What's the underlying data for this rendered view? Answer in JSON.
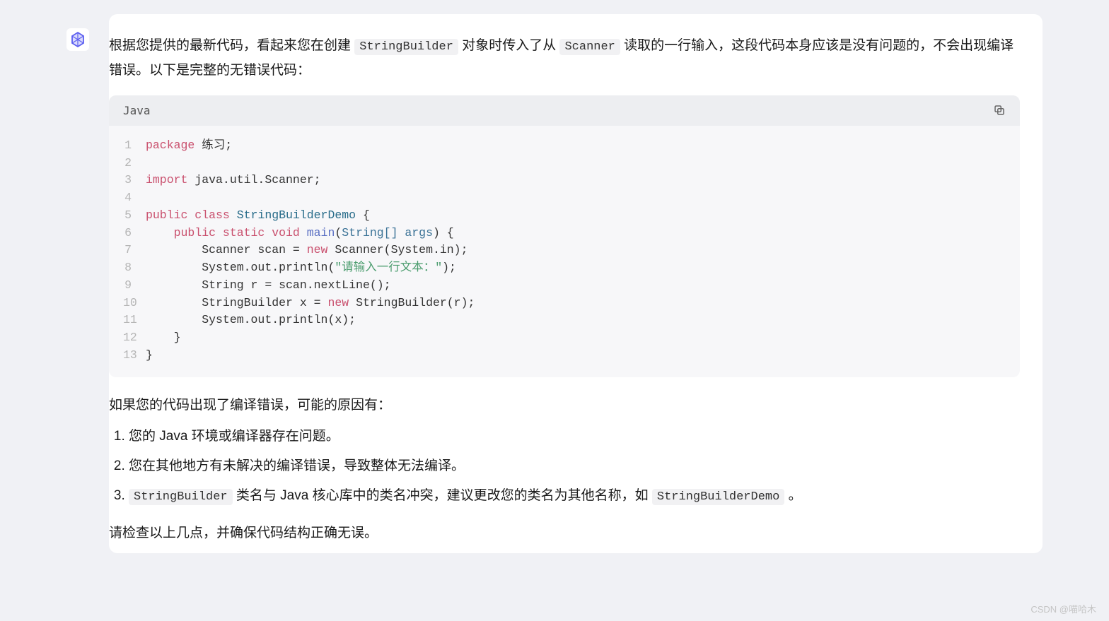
{
  "intro": {
    "part1": "根据您提供的最新代码，看起来您在创建 ",
    "code1": "StringBuilder",
    "part2": " 对象时传入了从 ",
    "code2": "Scanner",
    "part3": " 读取的一行输入，这段代码本身应该是没有问题的，不会出现编译错误。以下是完整的无错误代码："
  },
  "code_header": {
    "lang": "Java"
  },
  "code_lines": [
    {
      "n": "1",
      "tokens": [
        {
          "t": "package ",
          "c": "kw"
        },
        {
          "t": "练习;",
          "c": ""
        }
      ]
    },
    {
      "n": "2",
      "tokens": []
    },
    {
      "n": "3",
      "tokens": [
        {
          "t": "import ",
          "c": "kw"
        },
        {
          "t": "java.util.Scanner;",
          "c": ""
        }
      ]
    },
    {
      "n": "4",
      "tokens": []
    },
    {
      "n": "5",
      "tokens": [
        {
          "t": "public class ",
          "c": "kw"
        },
        {
          "t": "StringBuilderDemo",
          "c": "cls"
        },
        {
          "t": " {",
          "c": ""
        }
      ]
    },
    {
      "n": "6",
      "tokens": [
        {
          "t": "    ",
          "c": ""
        },
        {
          "t": "public static void ",
          "c": "kw"
        },
        {
          "t": "main",
          "c": "fn"
        },
        {
          "t": "(",
          "c": ""
        },
        {
          "t": "String[] args",
          "c": "param"
        },
        {
          "t": ") {",
          "c": ""
        }
      ]
    },
    {
      "n": "7",
      "tokens": [
        {
          "t": "        Scanner scan = ",
          "c": ""
        },
        {
          "t": "new ",
          "c": "kw"
        },
        {
          "t": "Scanner(System.in);",
          "c": ""
        }
      ]
    },
    {
      "n": "8",
      "tokens": [
        {
          "t": "        System.out.println(",
          "c": ""
        },
        {
          "t": "\"请输入一行文本：\"",
          "c": "str"
        },
        {
          "t": ");",
          "c": ""
        }
      ]
    },
    {
      "n": "9",
      "tokens": [
        {
          "t": "        String r = scan.nextLine();",
          "c": ""
        }
      ]
    },
    {
      "n": "10",
      "tokens": [
        {
          "t": "        StringBuilder x = ",
          "c": ""
        },
        {
          "t": "new ",
          "c": "kw"
        },
        {
          "t": "StringBuilder(r);",
          "c": ""
        }
      ]
    },
    {
      "n": "11",
      "tokens": [
        {
          "t": "        System.out.println(x);",
          "c": ""
        }
      ]
    },
    {
      "n": "12",
      "tokens": [
        {
          "t": "    }",
          "c": ""
        }
      ]
    },
    {
      "n": "13",
      "tokens": [
        {
          "t": "}",
          "c": ""
        }
      ]
    }
  ],
  "sub_heading": "如果您的代码出现了编译错误，可能的原因有：",
  "reasons": {
    "r1": "您的 Java 环境或编译器存在问题。",
    "r2": "您在其他地方有未解决的编译错误，导致整体无法编译。",
    "r3": {
      "code1": "StringBuilder",
      "mid": " 类名与 Java 核心库中的类名冲突，建议更改您的类名为其他名称，如 ",
      "code2": "StringBuilderDemo",
      "tail": " 。"
    }
  },
  "closing": "请检查以上几点，并确保代码结构正确无误。",
  "watermark": "CSDN @喵哈木"
}
